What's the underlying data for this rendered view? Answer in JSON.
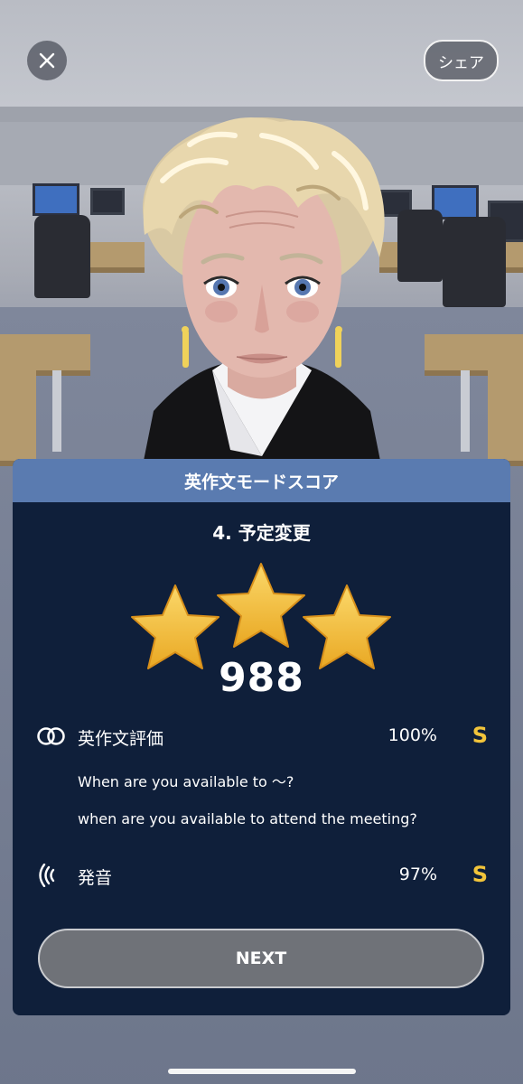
{
  "top_bar": {
    "close_icon": "close-icon",
    "share_label": "シェア"
  },
  "panel": {
    "header": "英作文モードスコア",
    "lesson_title": "4. 予定変更",
    "stars_earned": 3,
    "stars_total": 3,
    "score": "988",
    "writing": {
      "icon": "overlap-circles-icon",
      "label": "英作文評価",
      "percent": "100%",
      "grade": "S",
      "prompt": "When are you available to ～?",
      "answer": "when are you available to attend the meeting?"
    },
    "pronunciation": {
      "icon": "sound-wave-icon",
      "label": "発音",
      "percent": "97%",
      "grade": "S"
    },
    "next_label": "NEXT"
  },
  "colors": {
    "header_bg": "#5a7bb0",
    "panel_bg": "#0f1f3a",
    "grade": "#f2c43a",
    "star": "#f4c542"
  }
}
